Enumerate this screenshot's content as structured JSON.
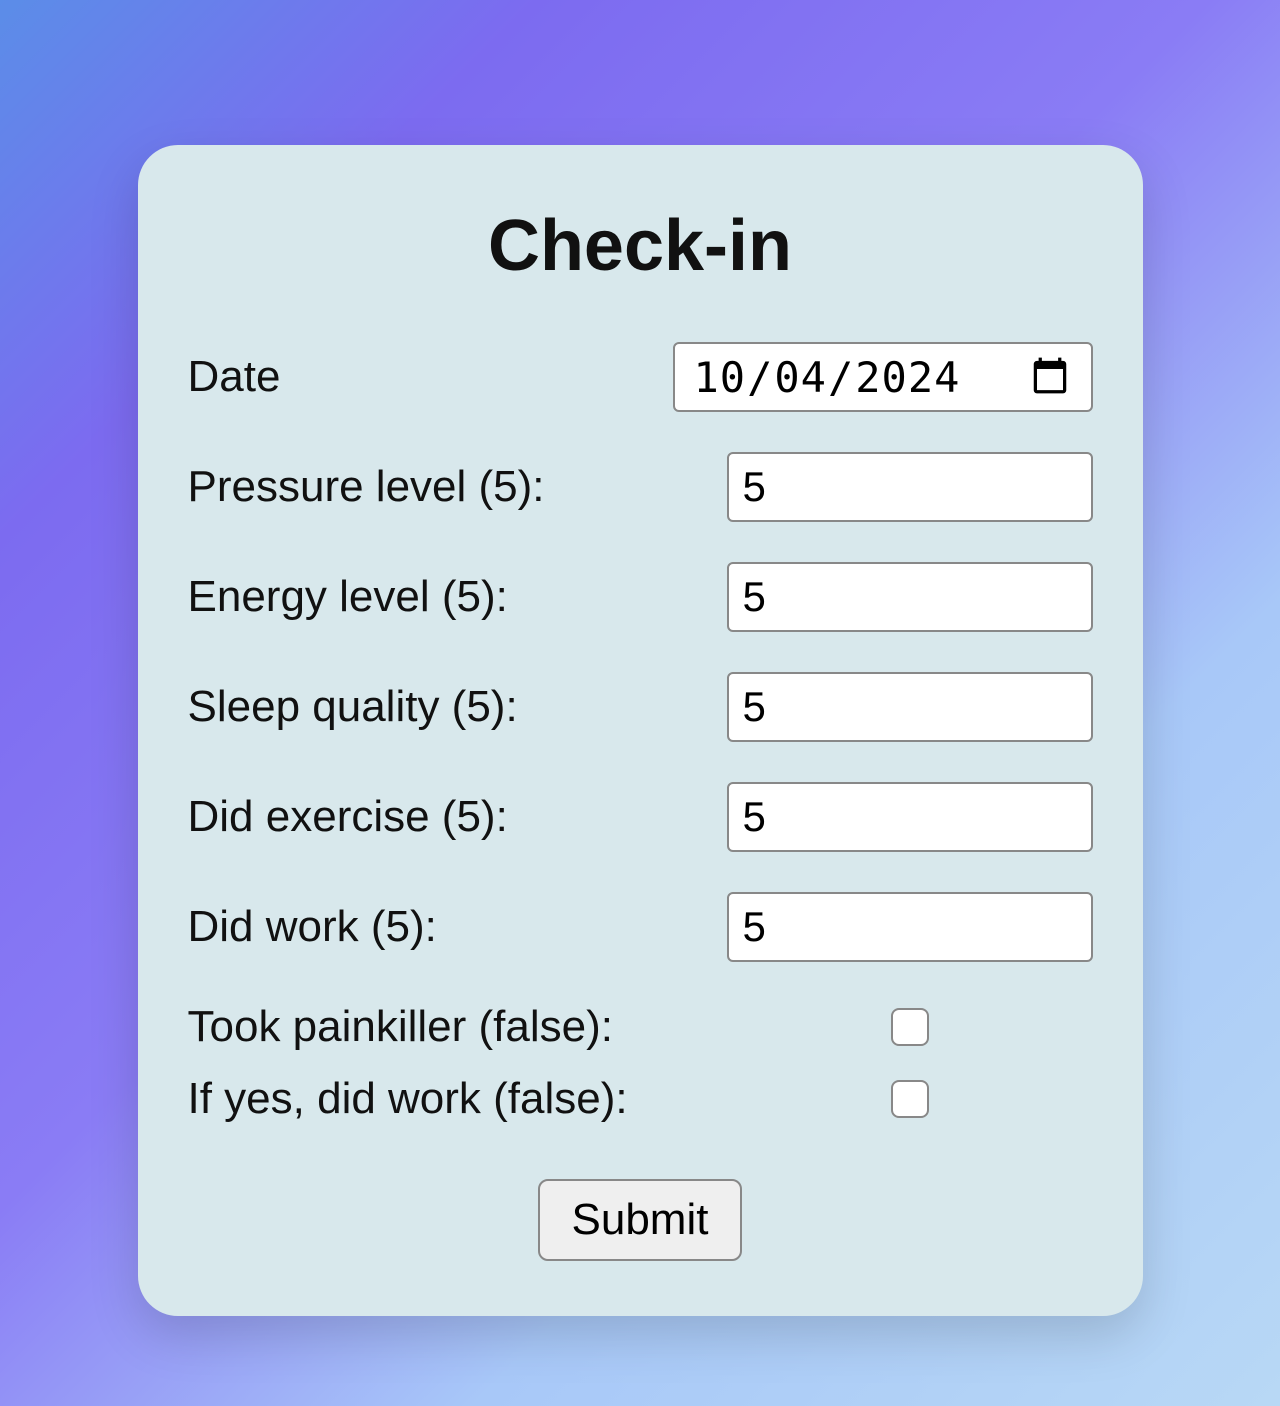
{
  "title": "Check-in",
  "fields": {
    "date": {
      "label": "Date",
      "value": "2024-10-04"
    },
    "pressure": {
      "label": "Pressure level (5):",
      "value": "5"
    },
    "energy": {
      "label": "Energy level (5):",
      "value": "5"
    },
    "sleep": {
      "label": "Sleep quality (5):",
      "value": "5"
    },
    "exercise": {
      "label": "Did exercise (5):",
      "value": "5"
    },
    "work": {
      "label": "Did work (5):",
      "value": "5"
    },
    "painkiller": {
      "label": "Took painkiller (false):",
      "checked": false
    },
    "painkiller_worked": {
      "label": "If yes, did work (false):",
      "checked": false
    }
  },
  "submit_label": "Submit"
}
